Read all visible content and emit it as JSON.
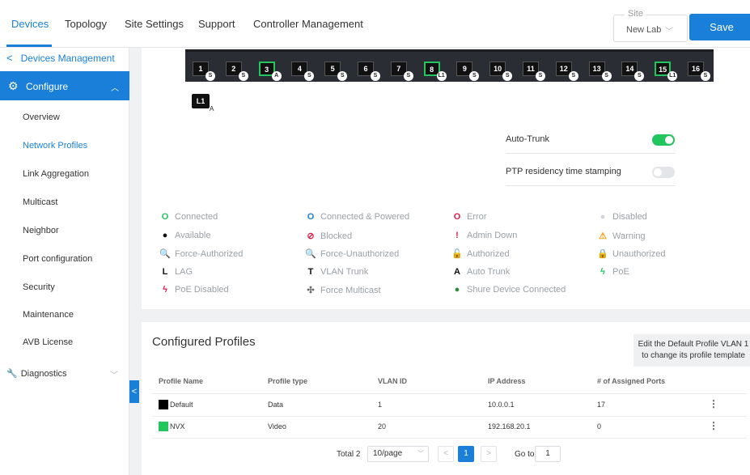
{
  "nav": {
    "tabs": [
      "Devices",
      "Topology",
      "Site Settings",
      "Support",
      "Controller Management"
    ],
    "active": "Devices"
  },
  "site": {
    "legend": "Site",
    "value": "New Lab"
  },
  "save_label": "Save",
  "sidebar": {
    "back_label": "Devices Management",
    "section": "Configure",
    "items": [
      "Overview",
      "Network Profiles",
      "Link Aggregation",
      "Multicast",
      "Neighbor",
      "Port configuration",
      "Security",
      "Maintenance",
      "AVB License"
    ],
    "selected": "Network Profiles",
    "diagnostics": "Diagnostics"
  },
  "switch": {
    "ports": [
      {
        "n": "1",
        "badge": "S",
        "connected": false
      },
      {
        "n": "2",
        "badge": "S",
        "connected": false
      },
      {
        "n": "3",
        "badge": "A",
        "connected": true
      },
      {
        "n": "4",
        "badge": "S",
        "connected": false
      },
      {
        "n": "5",
        "badge": "S",
        "connected": false
      },
      {
        "n": "6",
        "badge": "S",
        "connected": false
      },
      {
        "n": "7",
        "badge": "S",
        "connected": false
      },
      {
        "n": "8",
        "badge": "L1",
        "connected": true
      },
      {
        "n": "9",
        "badge": "S",
        "connected": false
      },
      {
        "n": "10",
        "badge": "S",
        "connected": false
      },
      {
        "n": "11",
        "badge": "S",
        "connected": false
      },
      {
        "n": "12",
        "badge": "S",
        "connected": false
      },
      {
        "n": "13",
        "badge": "S",
        "connected": false
      },
      {
        "n": "14",
        "badge": "S",
        "connected": false
      },
      {
        "n": "15",
        "badge": "L1",
        "connected": true
      },
      {
        "n": "16",
        "badge": "S",
        "connected": false
      }
    ],
    "lag_label": "L1",
    "lag_sub": "A"
  },
  "options": [
    {
      "label": "Auto-Trunk",
      "on": true
    },
    {
      "label": "PTP residency time stamping",
      "on": false
    }
  ],
  "legend": [
    {
      "sym": "O",
      "color": "#22c55e",
      "text": "Connected"
    },
    {
      "sym": "O",
      "color": "#1a7fd9",
      "text": "Connected & Powered"
    },
    {
      "sym": "O",
      "color": "#e11d48",
      "text": "Error"
    },
    {
      "sym": "●",
      "color": "#d1d5db",
      "text": "Disabled"
    },
    {
      "sym": "●",
      "color": "#111111",
      "text": "Available"
    },
    {
      "sym": "⊘",
      "color": "#e11d48",
      "text": "Blocked"
    },
    {
      "sym": "!",
      "color": "#e11d48",
      "text": "Admin Down"
    },
    {
      "sym": "⚠",
      "color": "#f59e0b",
      "text": "Warning"
    },
    {
      "sym": "🔍",
      "color": "#111111",
      "text": "Force-Authorized"
    },
    {
      "sym": "🔍",
      "color": "#e11d48",
      "text": "Force-Unauthorized"
    },
    {
      "sym": "🔓",
      "color": "#111111",
      "text": "Authorized"
    },
    {
      "sym": "🔒",
      "color": "#111111",
      "text": "Unauthorized"
    },
    {
      "sym": "L",
      "color": "#111111",
      "text": "LAG"
    },
    {
      "sym": "T",
      "color": "#111111",
      "text": "VLAN Trunk"
    },
    {
      "sym": "A",
      "color": "#111111",
      "text": "Auto Trunk"
    },
    {
      "sym": "ϟ",
      "color": "#22c55e",
      "text": "PoE"
    },
    {
      "sym": "ϟ",
      "color": "#e11d48",
      "text": "PoE Disabled"
    },
    {
      "sym": "✣",
      "color": "#666666",
      "text": "Force Multicast"
    },
    {
      "sym": "●",
      "color": "#2e8b3a",
      "text": "Shure Device Connected"
    }
  ],
  "profiles": {
    "title": "Configured Profiles",
    "tooltip": [
      "Edit the Default Profile VLAN 1",
      "to change its profile template"
    ],
    "columns": [
      "Profile Name",
      "Profile type",
      "VLAN ID",
      "IP Address",
      "# of Assigned Ports"
    ],
    "rows": [
      {
        "name": "Default",
        "color": "#000000",
        "type": "Data",
        "vlan": "1",
        "ip": "10.0.0.1",
        "ports": "17"
      },
      {
        "name": "NVX",
        "color": "#22c55e",
        "type": "Video",
        "vlan": "20",
        "ip": "192.168.20.1",
        "ports": "0"
      }
    ]
  },
  "pagination": {
    "total": "Total 2",
    "per_page": "10/page",
    "current": "1",
    "goto_label": "Go to",
    "goto_value": "1"
  }
}
